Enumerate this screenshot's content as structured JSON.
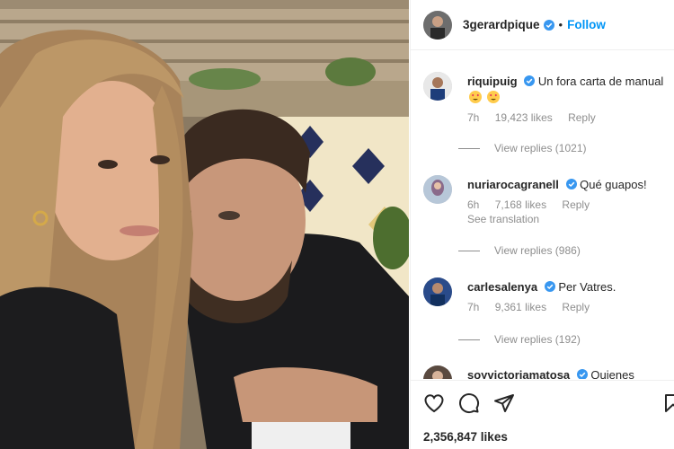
{
  "header": {
    "username": "3gerardpique",
    "separator": "•",
    "follow_label": "Follow"
  },
  "comments": [
    {
      "username": "riquipuig",
      "text": "Un fora carta de manual",
      "emojis": [
        "heart-eyes-emoji",
        "heart-eyes-emoji"
      ],
      "time": "7h",
      "likes": "19,423 likes",
      "reply_label": "Reply",
      "view_replies": "View replies (1021)"
    },
    {
      "username": "nuriarocagranell",
      "text": "Qué guapos!",
      "time": "6h",
      "likes": "7,168 likes",
      "reply_label": "Reply",
      "see_translation": "See translation",
      "view_replies": "View replies (986)"
    },
    {
      "username": "carlesalenya",
      "text": "Per Vatres.",
      "time": "7h",
      "likes": "9,361 likes",
      "reply_label": "Reply",
      "view_replies": "View replies (192)"
    },
    {
      "username": "soyvictoriamatosa",
      "text": "Quienes"
    }
  ],
  "actions": {
    "icons": [
      "heart-icon",
      "comment-icon",
      "share-icon",
      "bookmark-icon"
    ],
    "likes_count": "2,356,847 likes"
  },
  "colors": {
    "accent": "#0095f6",
    "verified": "#3897f0",
    "text": "#262626",
    "muted": "#8e8e8e",
    "border": "#efefef"
  }
}
